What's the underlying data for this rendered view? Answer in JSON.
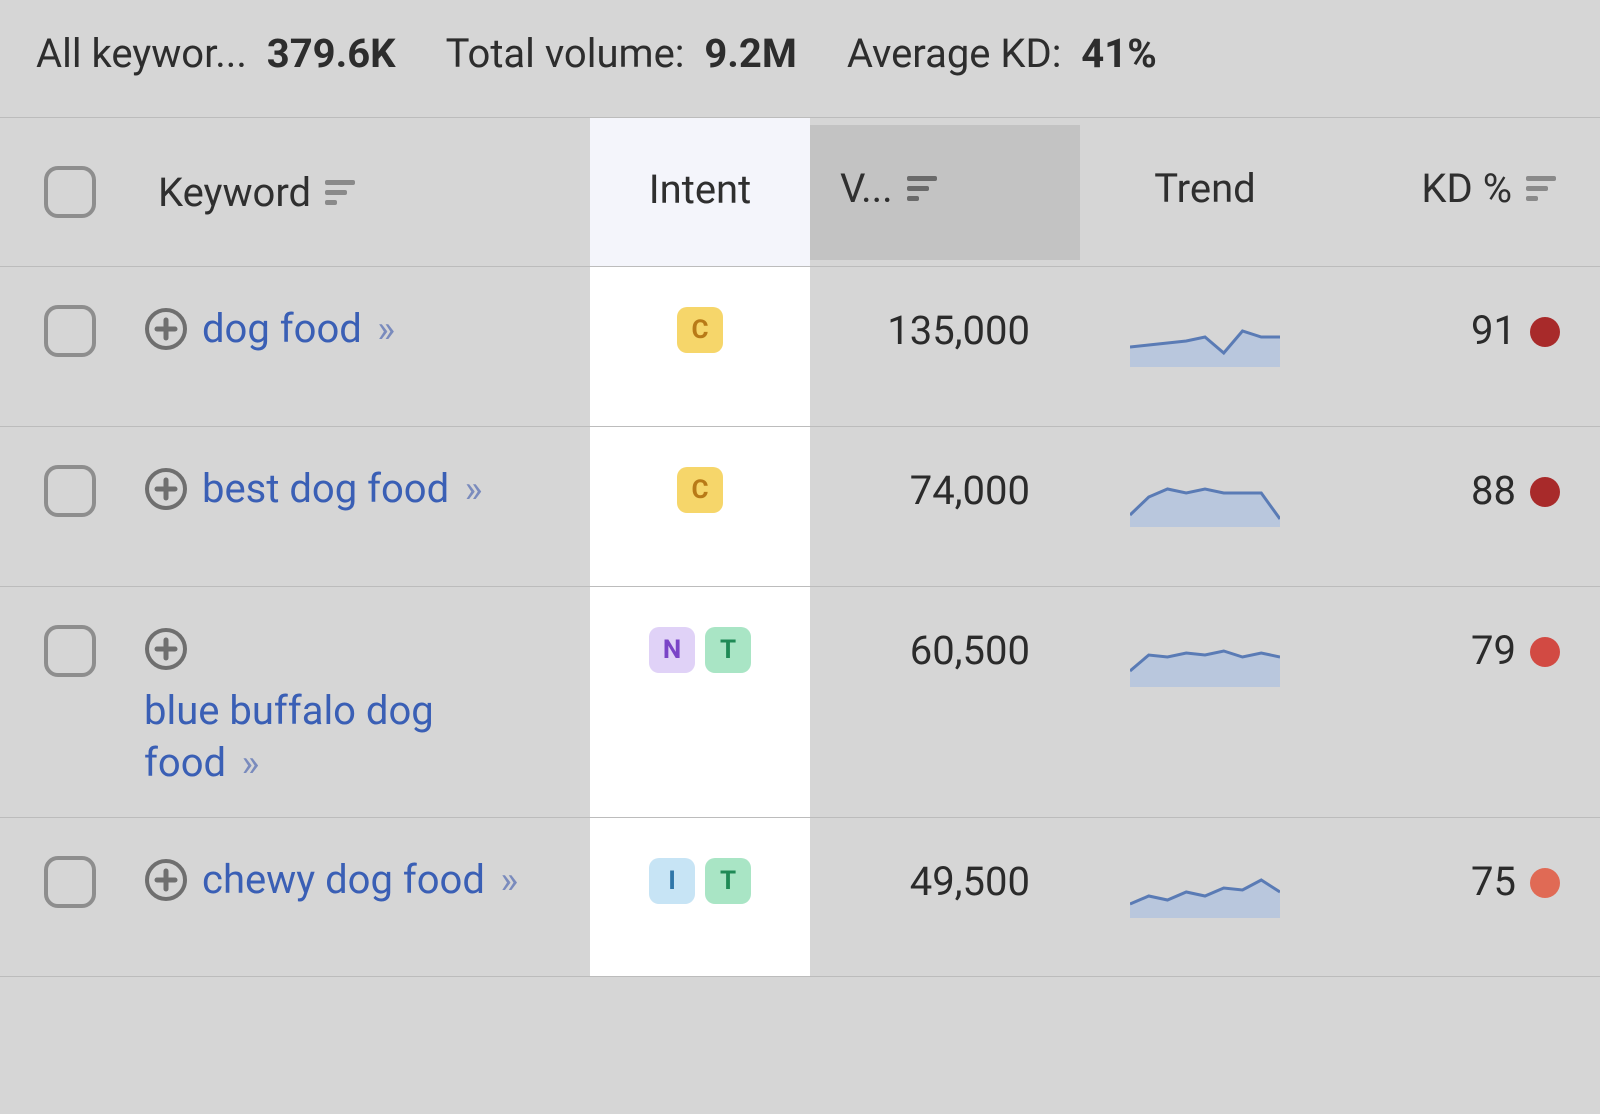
{
  "summary": {
    "all_keywords_label": "All keywor...",
    "all_keywords_value": "379.6K",
    "total_volume_label": "Total volume:",
    "total_volume_value": "9.2M",
    "avg_kd_label": "Average KD:",
    "avg_kd_value": "41%"
  },
  "columns": {
    "keyword": "Keyword",
    "intent": "Intent",
    "volume": "V...",
    "trend": "Trend",
    "kd": "KD %"
  },
  "intent_colors": {
    "C": "#f6d66a",
    "N": "#e0d2f7",
    "T": "#a9e5c5",
    "I": "#c7e4f5"
  },
  "kd_colors": {
    "very_hard": "#a82a2a",
    "hard": "#d24a43",
    "hard2": "#e06a55"
  },
  "rows": [
    {
      "keyword": "dog food",
      "intents": [
        "C"
      ],
      "volume": "135,000",
      "trend": [
        40,
        38,
        36,
        34,
        30,
        46,
        24,
        30,
        30
      ],
      "kd": "91",
      "kd_color": "#a82a2a"
    },
    {
      "keyword": "best dog food",
      "intents": [
        "C"
      ],
      "volume": "74,000",
      "trend": [
        48,
        30,
        22,
        26,
        22,
        26,
        26,
        26,
        52
      ],
      "kd": "88",
      "kd_color": "#a82a2a"
    },
    {
      "keyword": "blue buffalo dog food",
      "intents": [
        "N",
        "T"
      ],
      "volume": "60,500",
      "trend": [
        44,
        28,
        30,
        26,
        28,
        24,
        30,
        26,
        30
      ],
      "kd": "79",
      "kd_color": "#d24a43"
    },
    {
      "keyword": "chewy dog food",
      "intents": [
        "I",
        "T"
      ],
      "volume": "49,500",
      "trend": [
        46,
        38,
        42,
        34,
        38,
        30,
        32,
        22,
        34
      ],
      "kd": "75",
      "kd_color": "#e06a55"
    }
  ]
}
